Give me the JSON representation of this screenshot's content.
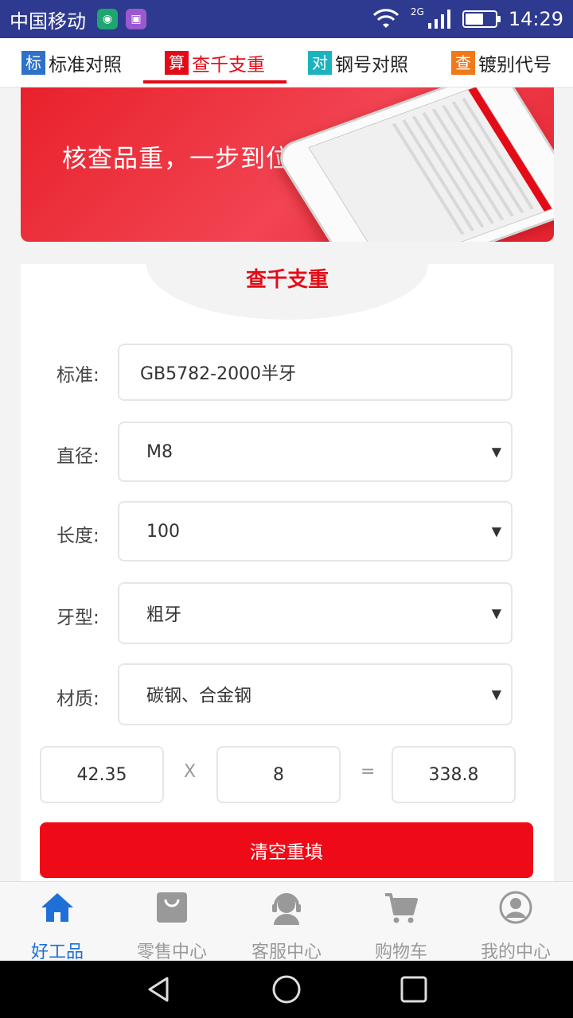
{
  "status_bar": {
    "carrier": "中国移动",
    "network": "2G",
    "time": "14:29",
    "battery_level": 0.6
  },
  "tabs": [
    {
      "badge": "标",
      "label": "标准对照",
      "badge_color": "#2d72c8",
      "active": false
    },
    {
      "badge": "算",
      "label": "查千支重",
      "badge_color": "#e30b17",
      "active": true
    },
    {
      "badge": "对",
      "label": "钢号对照",
      "badge_color": "#1cb3c0",
      "active": false
    },
    {
      "badge": "查",
      "label": "镀别代号",
      "badge_color": "#f07a1a",
      "active": false
    }
  ],
  "banner": {
    "text": "核查品重，一步到位"
  },
  "card": {
    "title": "查千支重"
  },
  "form": {
    "standard": {
      "label": "标准:",
      "value": "GB5782-2000半牙"
    },
    "diameter": {
      "label": "直径:",
      "value": "M8"
    },
    "length": {
      "label": "长度:",
      "value": "100"
    },
    "thread": {
      "label": "牙型:",
      "value": "粗牙"
    },
    "material": {
      "label": "材质:",
      "value": "碳钢、合金钢"
    },
    "select_arrow": "▼"
  },
  "calc": {
    "unit_weight": "42.35",
    "times": "X",
    "quantity": "8",
    "equals": "=",
    "result": "338.8"
  },
  "reset_button": {
    "label": "清空重填"
  },
  "bottom_nav": [
    {
      "label": "好工品",
      "icon": "home-icon",
      "active": true
    },
    {
      "label": "零售中心",
      "icon": "bag-icon",
      "active": false
    },
    {
      "label": "客服中心",
      "icon": "headset-icon",
      "active": false
    },
    {
      "label": "购物车",
      "icon": "cart-icon",
      "active": false
    },
    {
      "label": "我的中心",
      "icon": "user-icon",
      "active": false
    }
  ],
  "colors": {
    "accent": "#e30b17",
    "status_bar": "#2e3a8f",
    "nav_active": "#1e6fd8"
  }
}
